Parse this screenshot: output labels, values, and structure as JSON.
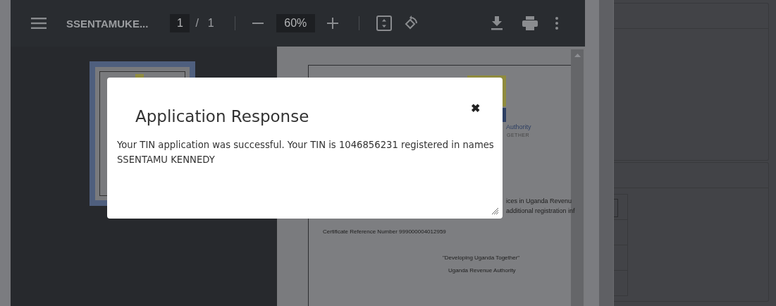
{
  "toolbar": {
    "title": "SSENTAMUKE...",
    "page_current": "1",
    "page_separator": "/",
    "page_total": "1",
    "zoom": "60%"
  },
  "document": {
    "logo_text": "Authority",
    "logo_tagline": "GETHER",
    "lines": [
      "ices in Uganda Revenu",
      "additional registration inf"
    ],
    "reference": "Certificate Reference Number 999000004012959",
    "motto": "\"Developing Uganda Together\"",
    "issuer": "Uganda Revenue Authority"
  },
  "dialog": {
    "title": "Application Response",
    "close": "✖",
    "message": "Your TIN application was successful. Your TIN is 1046856231 registered in names SSENTAMU KENNEDY"
  }
}
